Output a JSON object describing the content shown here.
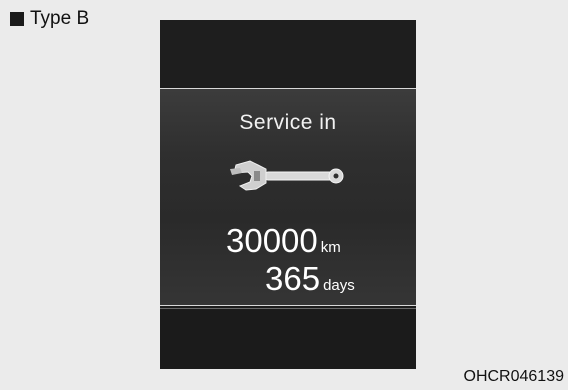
{
  "header": {
    "type_label": "Type B"
  },
  "display": {
    "title": "Service in",
    "distance_value": "30000",
    "distance_unit": "km",
    "days_value": "365",
    "days_unit": "days",
    "icon": "wrench-icon"
  },
  "footer": {
    "image_code": "OHCR046139"
  },
  "colors": {
    "background": "#ebebeb",
    "display": "#1d1d1d",
    "text": "#ffffff"
  }
}
